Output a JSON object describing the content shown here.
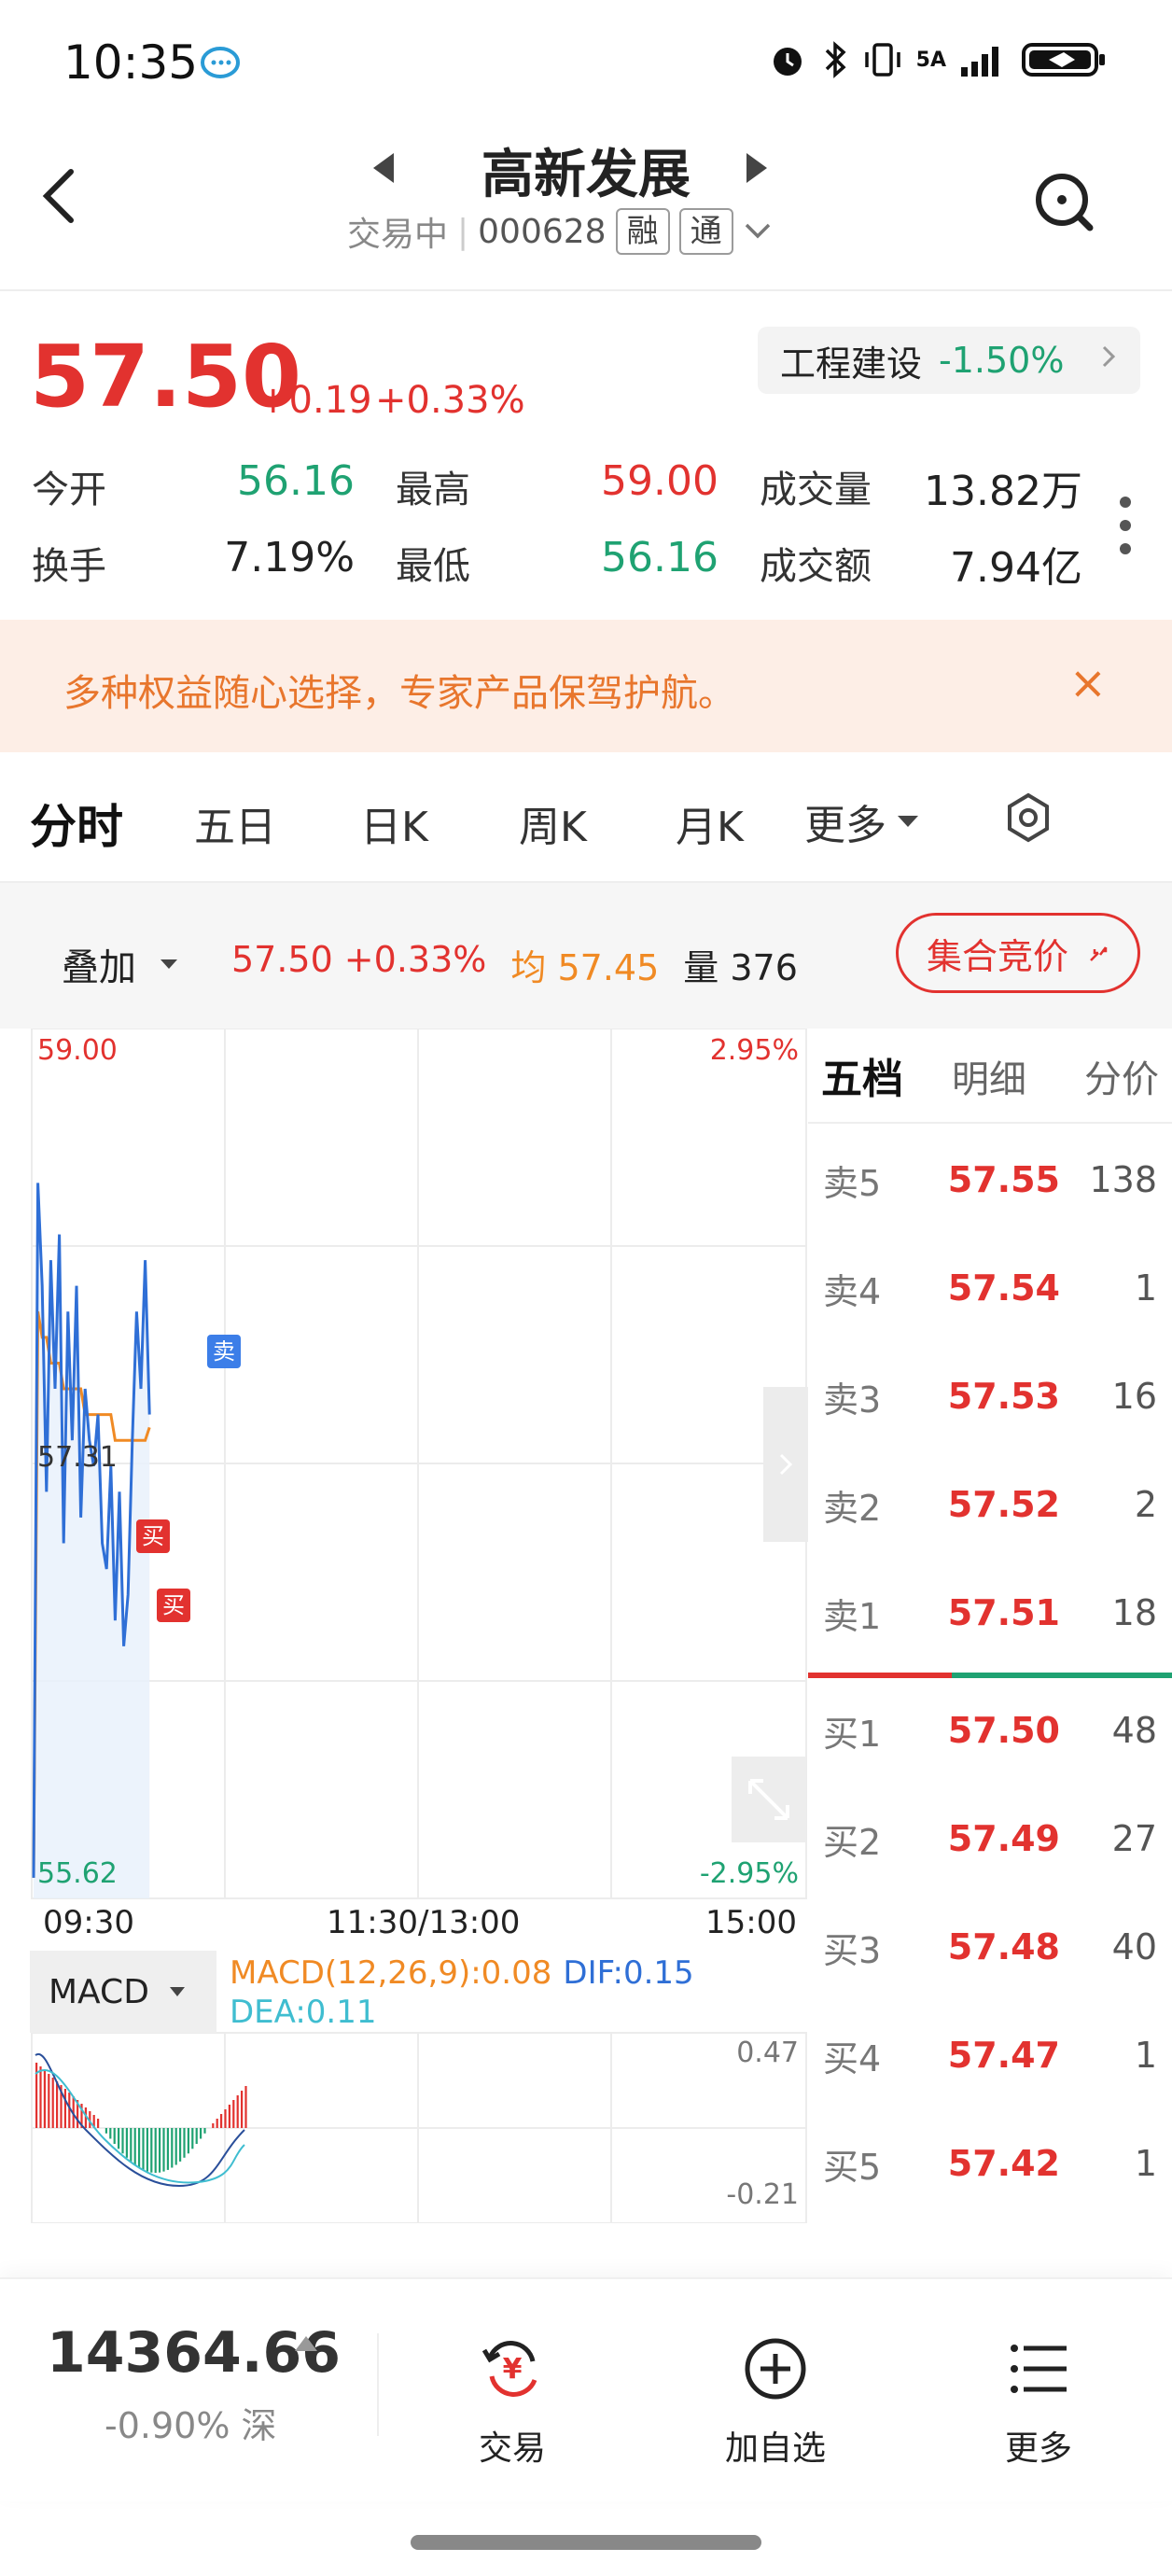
{
  "status_bar": {
    "time": "10:35",
    "icons": [
      "alarm-icon",
      "bluetooth-icon",
      "vibrate-icon",
      "signal-5g-icon",
      "battery-icon"
    ],
    "signal_label": "5A"
  },
  "header": {
    "title": "高新发展",
    "trading_status": "交易中",
    "code": "000628",
    "tag_margin": "融",
    "tag_connect": "通"
  },
  "quote": {
    "price": "57.50",
    "change": "+0.19",
    "change_pct": "+0.33%",
    "sector_name": "工程建设",
    "sector_pct": "-1.50%",
    "stats": [
      {
        "label": "今开",
        "value": "56.16",
        "color": "#1fa272"
      },
      {
        "label": "最高",
        "value": "59.00",
        "color": "#e2322f"
      },
      {
        "label": "成交量",
        "value": "13.82万",
        "color": "#222222"
      },
      {
        "label": "换手",
        "value": "7.19%",
        "color": "#222222"
      },
      {
        "label": "最低",
        "value": "56.16",
        "color": "#1fa272"
      },
      {
        "label": "成交额",
        "value": "7.94亿",
        "color": "#222222"
      }
    ]
  },
  "banner": {
    "text": "多种权益随心选择，专家产品保驾护航。",
    "close_symbol": "×"
  },
  "tabs": [
    "分时",
    "五日",
    "日K",
    "周K",
    "月K",
    "更多"
  ],
  "overlay": {
    "label": "叠加",
    "price": "57.50",
    "pct": "+0.33%",
    "avg_label": "均",
    "avg_value": "57.45",
    "vol_label": "量",
    "vol_value": "376",
    "auction_label": "集合竞价"
  },
  "chart": {
    "y_top": "59.00",
    "y_bottom": "55.62",
    "pct_top": "2.95%",
    "pct_bottom": "-2.95%",
    "mid_label": "57.31",
    "x_labels": [
      "09:30",
      "11:30/13:00",
      "15:00"
    ],
    "sell_marker": "卖",
    "buy_marker": "买",
    "macd_selector": "MACD",
    "macd_text": "MACD(12,26,9):0.08",
    "dif_text": "DIF:0.15",
    "dea_text": "DEA:0.11",
    "macd_top": "0.47",
    "macd_bottom": "-0.21"
  },
  "chart_data": {
    "type": "line",
    "ylim": [
      55.62,
      59.0
    ],
    "series": [
      {
        "values": [
          55.7,
          58.4,
          58.0,
          57.2,
          58.1,
          57.6,
          58.2,
          57.0,
          57.9,
          57.4,
          58.0,
          57.1,
          57.6,
          57.4,
          57.3,
          57.5,
          57.0,
          56.9,
          57.3,
          56.7,
          57.2,
          56.6,
          56.8,
          57.4,
          57.9,
          57.6,
          58.1,
          57.5
        ]
      },
      {
        "values": [
          55.7,
          57.9,
          57.8,
          57.8,
          57.7,
          57.7,
          57.7,
          57.6,
          57.6,
          57.6,
          57.6,
          57.6,
          57.5,
          57.5,
          57.5,
          57.5,
          57.5,
          57.5,
          57.5,
          57.4,
          57.4,
          57.4,
          57.4,
          57.4,
          57.4,
          57.4,
          57.4,
          57.45
        ]
      }
    ]
  },
  "order_book": {
    "tabs": [
      "五档",
      "明细",
      "分价"
    ],
    "sell": [
      {
        "label": "卖5",
        "price": "57.55",
        "vol": "138"
      },
      {
        "label": "卖4",
        "price": "57.54",
        "vol": "1"
      },
      {
        "label": "卖3",
        "price": "57.53",
        "vol": "16"
      },
      {
        "label": "卖2",
        "price": "57.52",
        "vol": "2"
      },
      {
        "label": "卖1",
        "price": "57.51",
        "vol": "18"
      }
    ],
    "buy": [
      {
        "label": "买1",
        "price": "57.50",
        "vol": "48"
      },
      {
        "label": "买2",
        "price": "57.49",
        "vol": "27"
      },
      {
        "label": "买3",
        "price": "57.48",
        "vol": "40"
      },
      {
        "label": "买4",
        "price": "57.47",
        "vol": "1"
      },
      {
        "label": "买5",
        "price": "57.42",
        "vol": "1"
      }
    ]
  },
  "bottom_bar": {
    "index_value": "14364.66",
    "index_pct": "-0.90%",
    "index_name": "深",
    "trade_label": "交易",
    "trade_symbol": "¥",
    "watch_label": "加自选",
    "more_label": "更多"
  }
}
